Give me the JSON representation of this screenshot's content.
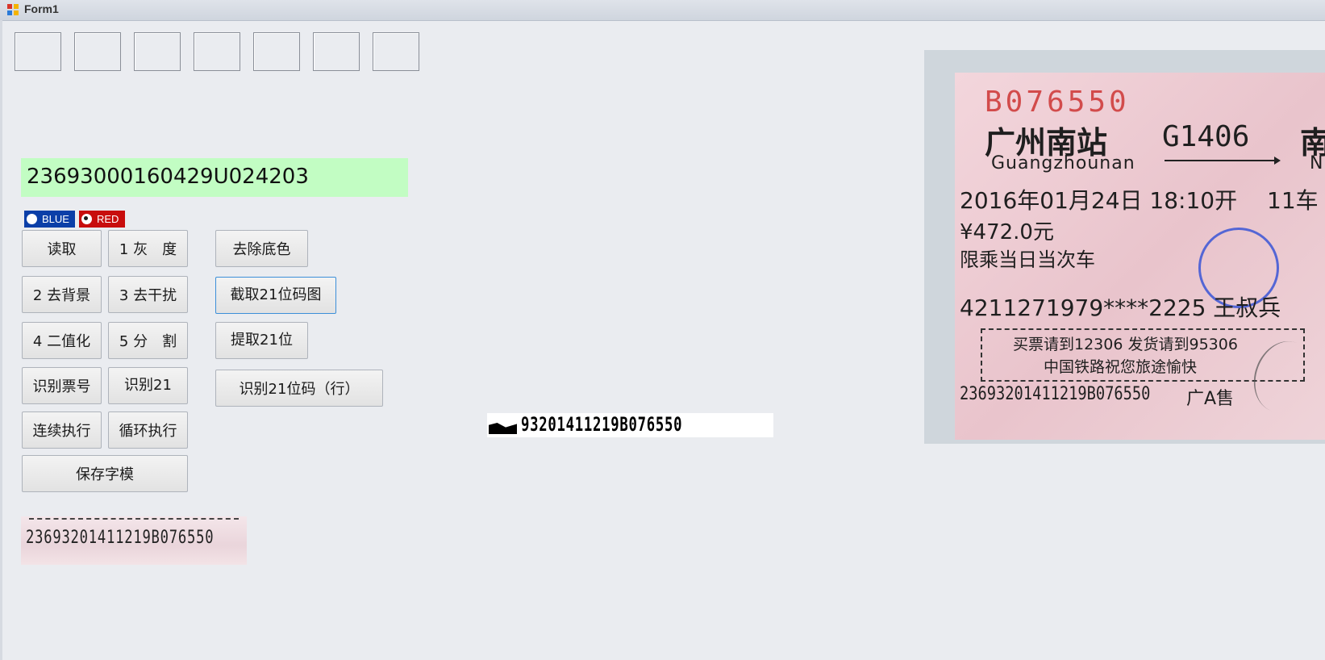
{
  "window": {
    "title": "Form1",
    "icon": "form-app-icon"
  },
  "digit_boxes": [
    "",
    "",
    "",
    "",
    "",
    "",
    ""
  ],
  "result_text": "23693000160429U024203",
  "color_options": [
    {
      "label": "BLUE",
      "selected": false,
      "color": "#0b3fa8"
    },
    {
      "label": "RED",
      "selected": true,
      "color": "#c80d0d"
    }
  ],
  "buttons": {
    "read": "读取",
    "gray": "1 灰　度",
    "remove_bg_color": "去除底色",
    "remove_background": "2 去背景",
    "denoise": "3 去干扰",
    "crop_21": "截取21位码图",
    "binarize": "4 二值化",
    "split": "5 分　割",
    "extract_21": "提取21位",
    "recognize_ticket_no": "识别票号",
    "recognize_21": "识别21",
    "recognize_21_row": "识别21位码（行）",
    "continuous_run": "连续执行",
    "loop_run": "循环执行",
    "save_template": "保存字模"
  },
  "strip_small_text": "23693201411219B076550",
  "strip_binary_text": "93201411219B076550",
  "ticket": {
    "serial": "B076550",
    "from_station": "广州南站",
    "from_pinyin": "Guangzhounan",
    "train_no": "G1406",
    "to_station": "南",
    "to_pinyin": "N",
    "datetime": "2016年01月24日 18:10开",
    "seat": "11车",
    "price": "¥472.0元",
    "note": "限乘当日当次车",
    "id_line": "4211271979****2225 王叔兵",
    "notice_line1": "买票请到12306  发货请到95306",
    "notice_line2": "中国铁路祝您旅途愉快",
    "bottom_code": "23693201411219B076550",
    "bottom_station": "广A售"
  }
}
